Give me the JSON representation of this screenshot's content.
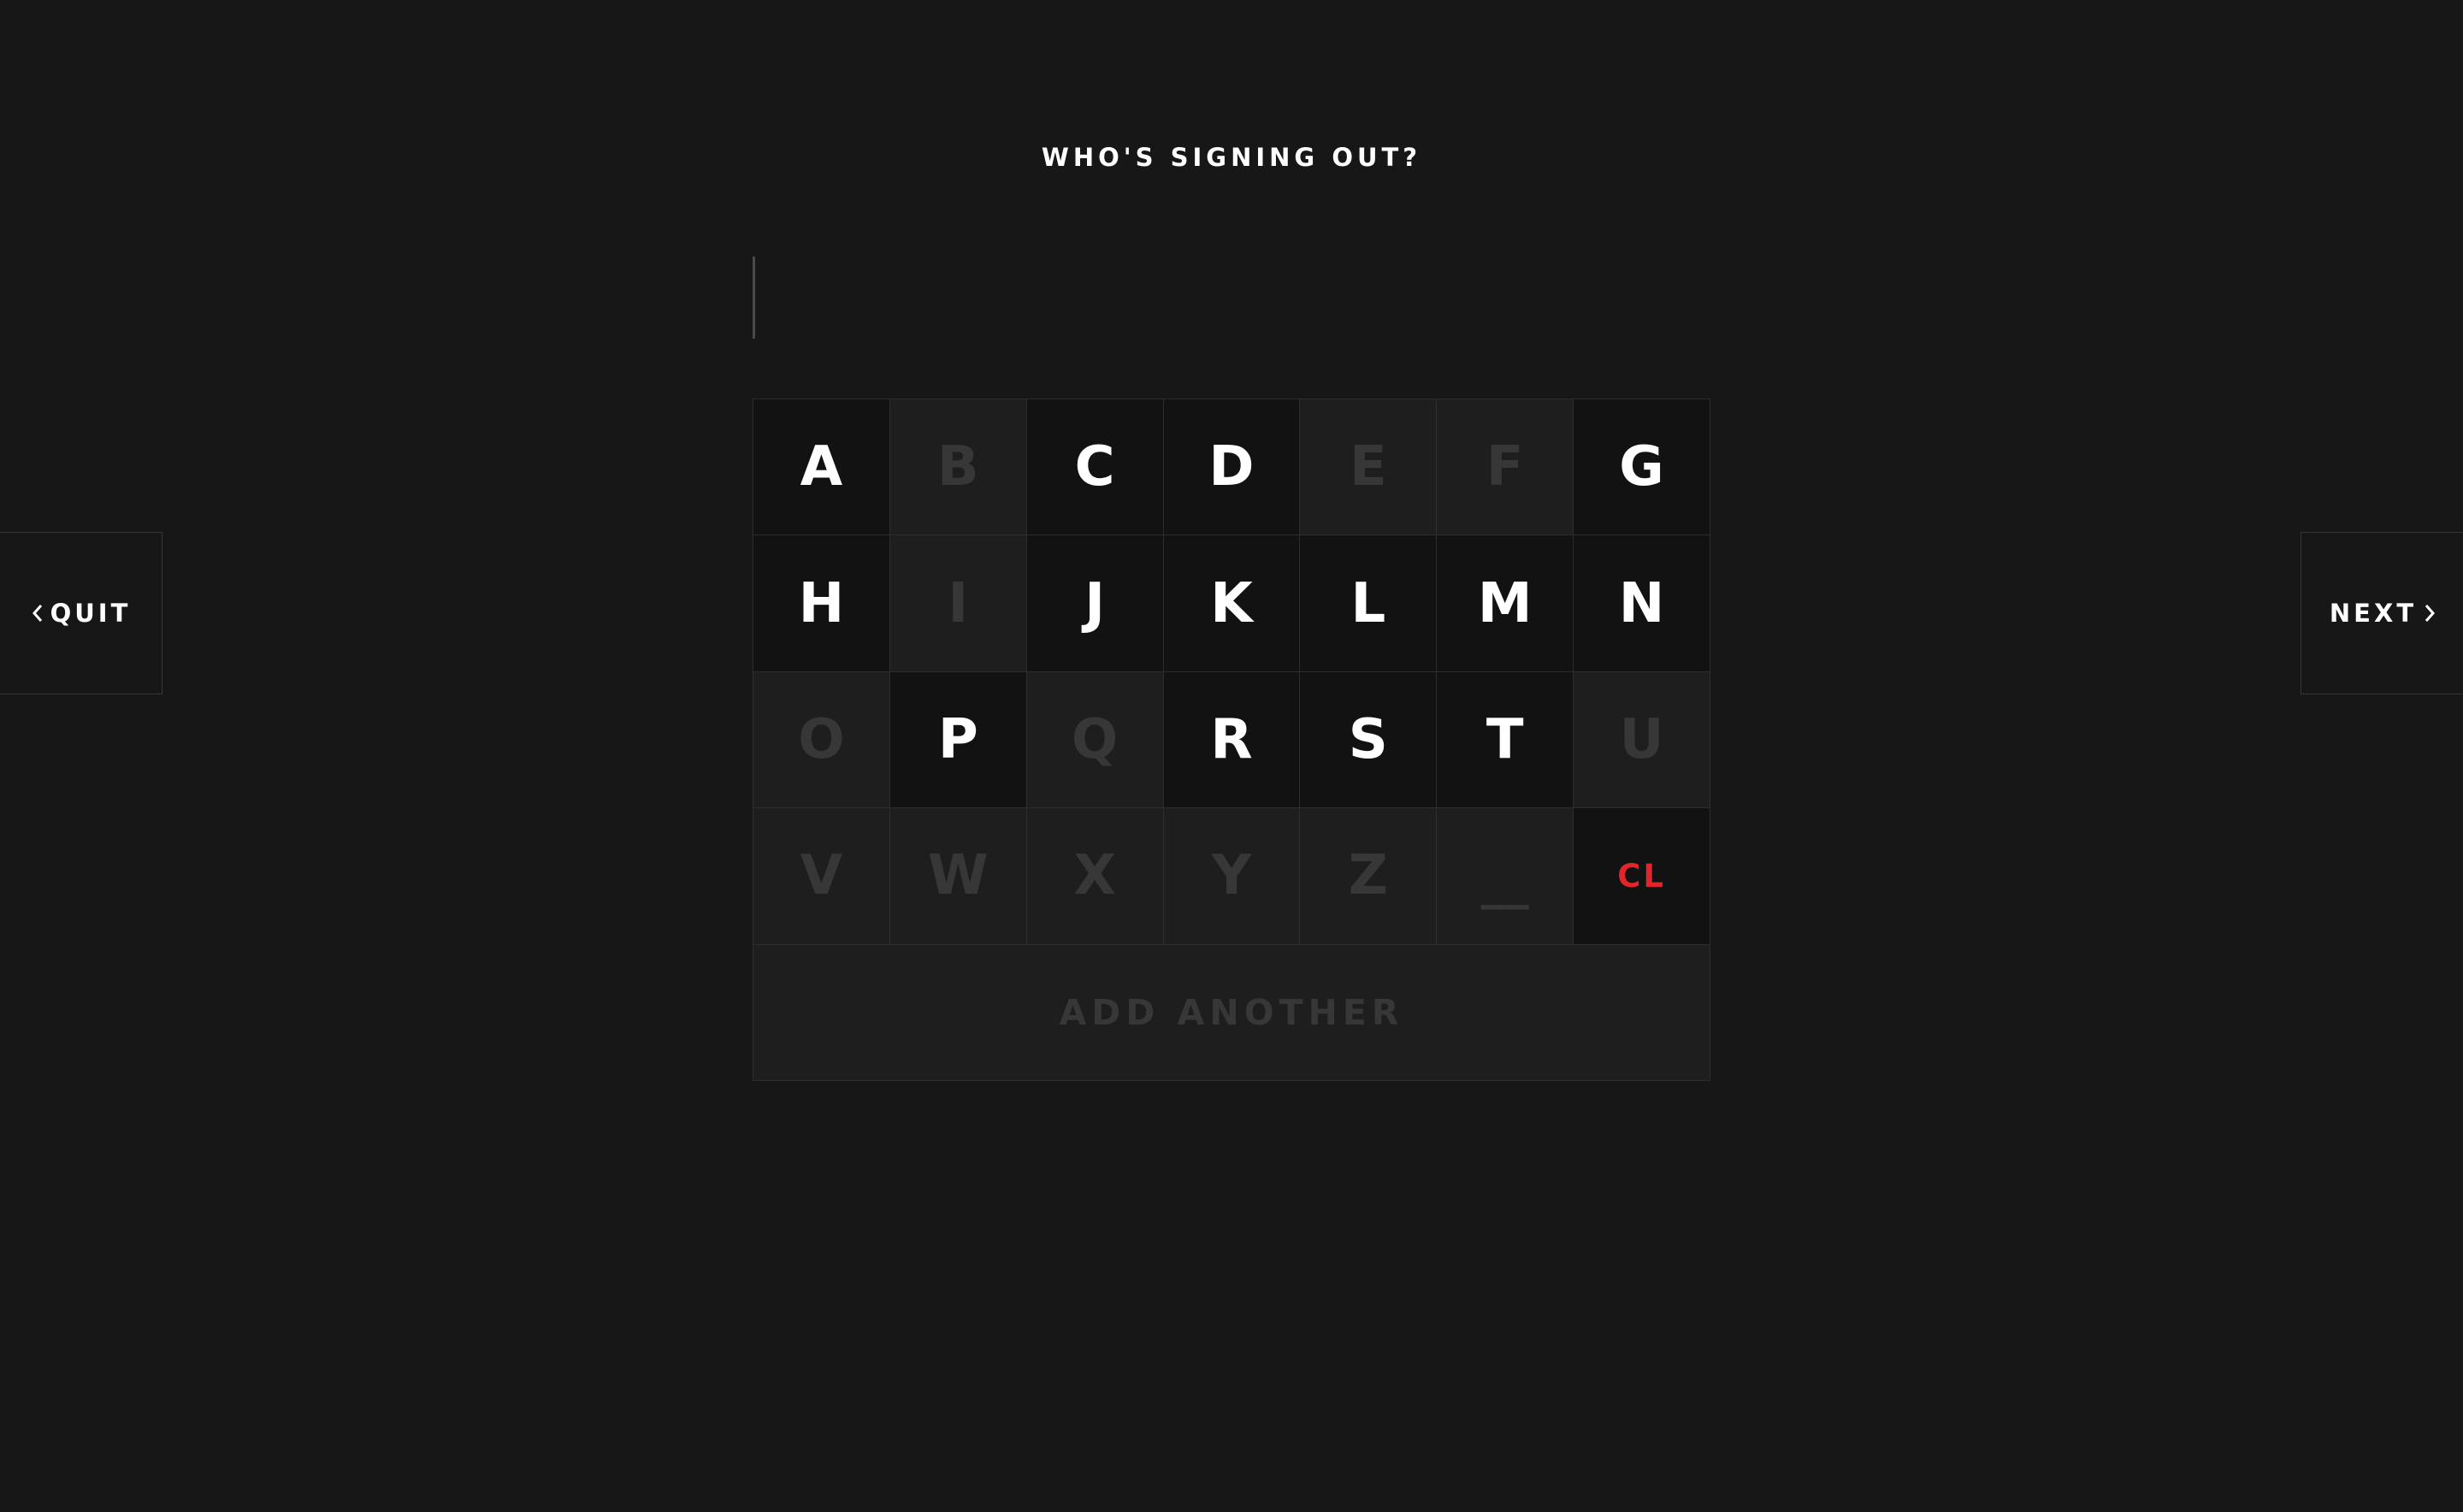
{
  "header": {
    "title": "WHO'S SIGNING OUT?"
  },
  "name_field": {
    "value": "",
    "placeholder": ""
  },
  "keypad": {
    "keys": [
      {
        "label": "A",
        "enabled": true
      },
      {
        "label": "B",
        "enabled": false
      },
      {
        "label": "C",
        "enabled": true
      },
      {
        "label": "D",
        "enabled": true
      },
      {
        "label": "E",
        "enabled": false
      },
      {
        "label": "F",
        "enabled": false
      },
      {
        "label": "G",
        "enabled": true
      },
      {
        "label": "H",
        "enabled": true
      },
      {
        "label": "I",
        "enabled": false
      },
      {
        "label": "J",
        "enabled": true
      },
      {
        "label": "K",
        "enabled": true
      },
      {
        "label": "L",
        "enabled": true
      },
      {
        "label": "M",
        "enabled": true
      },
      {
        "label": "N",
        "enabled": true
      },
      {
        "label": "O",
        "enabled": false
      },
      {
        "label": "P",
        "enabled": true
      },
      {
        "label": "Q",
        "enabled": false
      },
      {
        "label": "R",
        "enabled": true
      },
      {
        "label": "S",
        "enabled": true
      },
      {
        "label": "T",
        "enabled": true
      },
      {
        "label": "U",
        "enabled": false
      },
      {
        "label": "V",
        "enabled": false
      },
      {
        "label": "W",
        "enabled": false
      },
      {
        "label": "X",
        "enabled": false
      },
      {
        "label": "Y",
        "enabled": false
      },
      {
        "label": "Z",
        "enabled": false
      },
      {
        "label": "__",
        "enabled": false
      },
      {
        "label": "CL",
        "enabled": true
      }
    ],
    "add_another": {
      "label": "ADD ANOTHER",
      "enabled": false
    }
  },
  "nav": {
    "quit_label": "QUIT",
    "quit_icon": "chevron-left-icon",
    "next_label": "NEXT",
    "next_icon": "chevron-right-icon"
  },
  "colors": {
    "background": "#171717",
    "key_enabled_bg": "#121212",
    "key_disabled_bg": "#1e1e1e",
    "key_disabled_text": "#373737",
    "clear_text": "#e0262b",
    "text": "#ffffff"
  }
}
